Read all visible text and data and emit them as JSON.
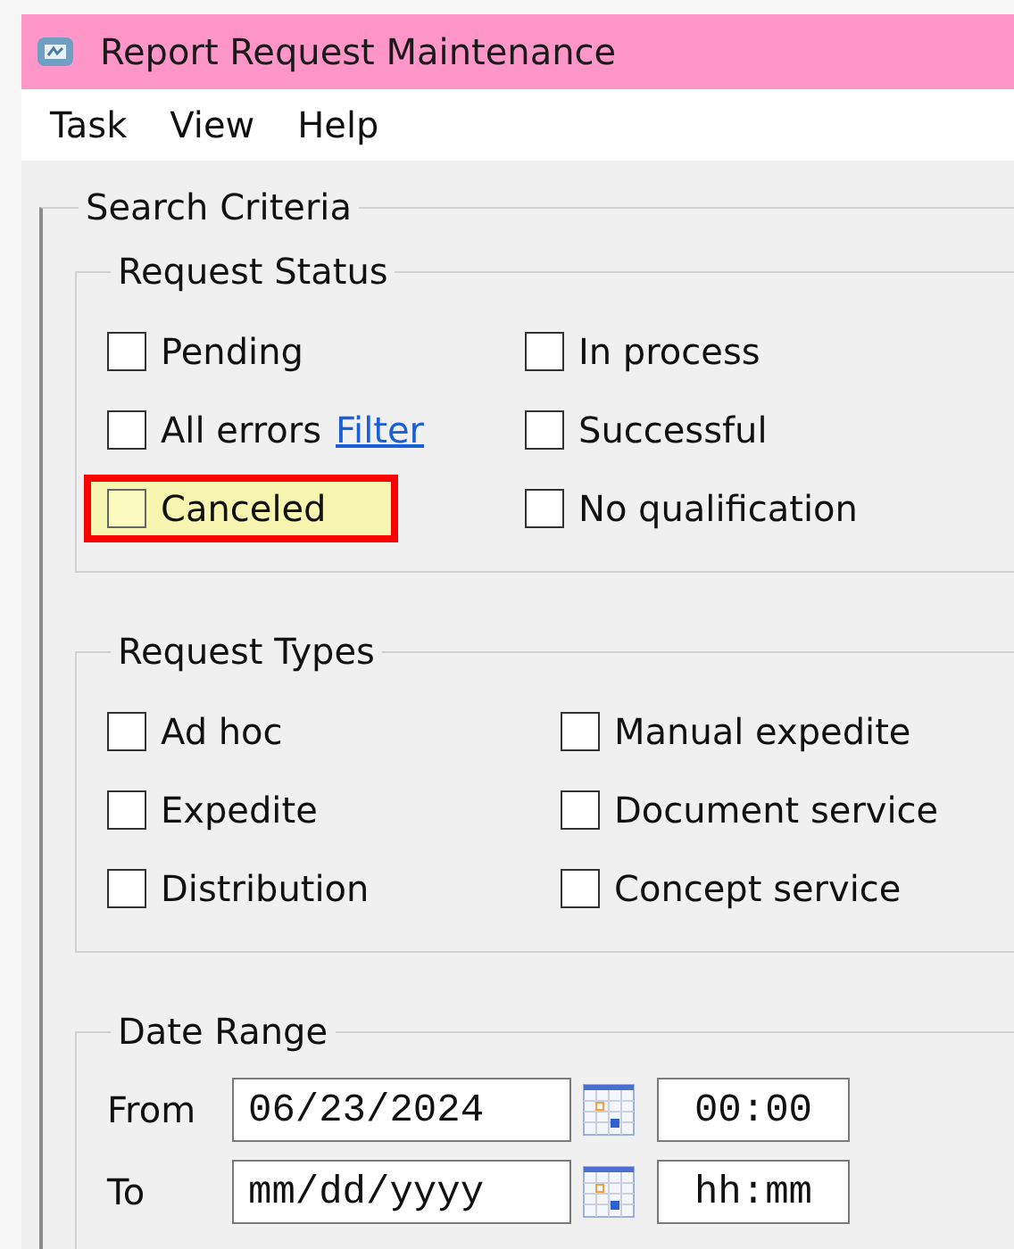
{
  "window": {
    "title": "Report Request Maintenance"
  },
  "menu": [
    "Task",
    "View",
    "Help"
  ],
  "search_criteria": {
    "title": "Search Criteria",
    "request_status": {
      "title": "Request Status",
      "items": [
        {
          "label": "Pending",
          "checked": false,
          "highlighted": false
        },
        {
          "label": "In process",
          "checked": false,
          "highlighted": false
        },
        {
          "label": "All errors",
          "checked": false,
          "highlighted": false,
          "link": "Filter"
        },
        {
          "label": "Successful",
          "checked": false,
          "highlighted": false
        },
        {
          "label": "Canceled",
          "checked": false,
          "highlighted": true
        },
        {
          "label": "No qualification",
          "checked": false,
          "highlighted": false
        }
      ]
    },
    "request_types": {
      "title": "Request Types",
      "items": [
        {
          "label": "Ad hoc",
          "checked": false,
          "highlighted": false
        },
        {
          "label": "Manual expedite",
          "checked": false,
          "highlighted": false
        },
        {
          "label": "Expedite",
          "checked": false,
          "highlighted": false
        },
        {
          "label": "Document service",
          "checked": false,
          "highlighted": false
        },
        {
          "label": "Distribution",
          "checked": false,
          "highlighted": false
        },
        {
          "label": "Concept service",
          "checked": false,
          "highlighted": false
        }
      ]
    },
    "date_range": {
      "title": "Date Range",
      "rows": [
        {
          "label": "From",
          "date": {
            "value": "06/23/2024"
          },
          "time": {
            "value": "00:00"
          }
        },
        {
          "label": "To",
          "date": {
            "placeholder": "mm/dd/yyyy"
          },
          "time": {
            "placeholder": "hh:mm"
          }
        }
      ]
    }
  }
}
